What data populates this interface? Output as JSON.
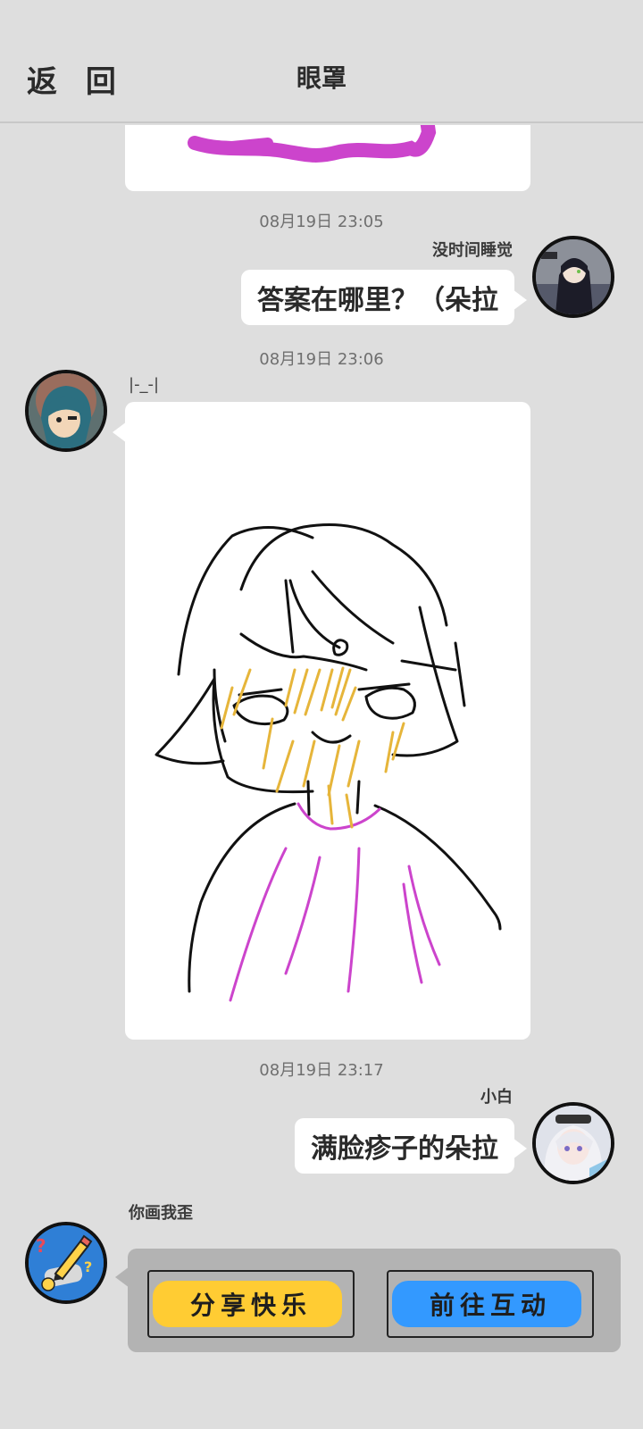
{
  "header": {
    "back_label": "返 回",
    "title": "眼罩"
  },
  "messages": {
    "ts1": "08月19日  23:05",
    "m1_sender": "没时间睡觉",
    "m1_text": "答案在哪里？（朵拉",
    "ts2": "08月19日  23:06",
    "m2_sender": "|-_-|",
    "ts3": "08月19日  23:17",
    "m3_sender": "小白",
    "m3_text": "满脸疹子的朵拉",
    "m4_sender": "你画我歪",
    "btn_share": "分享快乐",
    "btn_interact": "前往互动"
  },
  "colors": {
    "background": "#dedede",
    "share_button": "#ffcc33",
    "interact_button": "#3399ff",
    "drawing_pink": "#cc44cc",
    "drawing_yellow": "#e6b53a"
  },
  "icons": [
    "back",
    "avatar",
    "drawing"
  ]
}
